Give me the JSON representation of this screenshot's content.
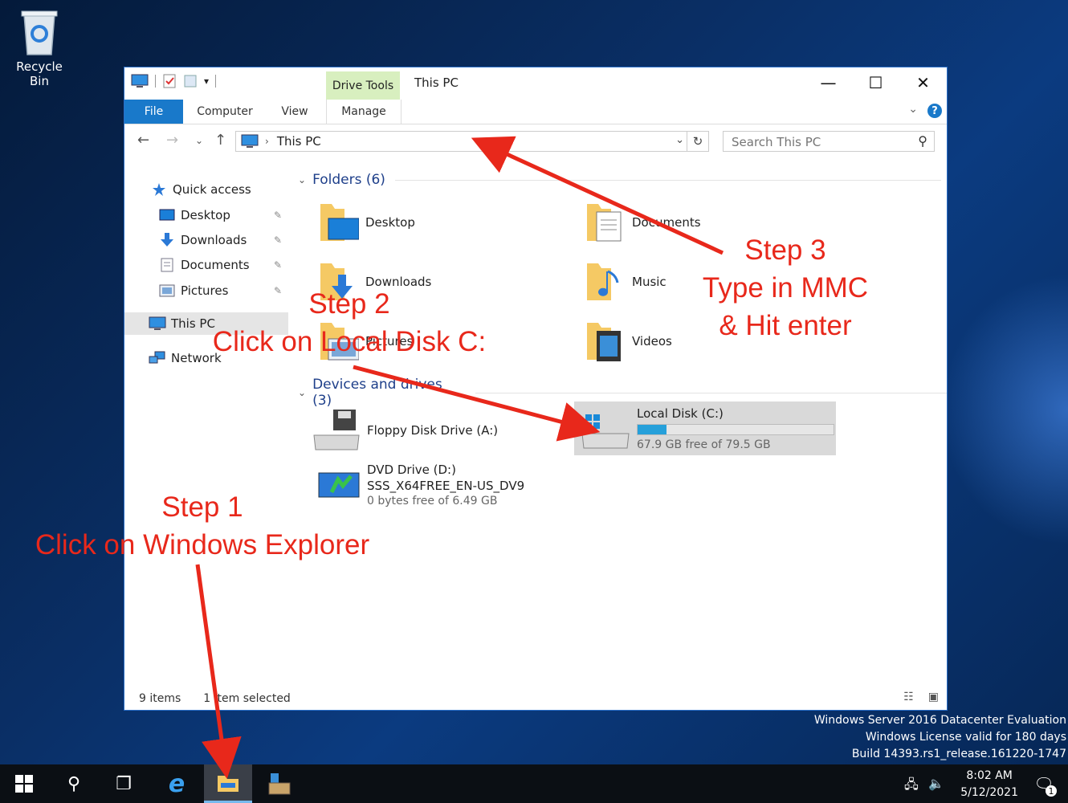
{
  "desktop": {
    "recycle_bin_label": "Recycle Bin"
  },
  "window": {
    "title": "This PC",
    "contextual_tab_header": "Drive Tools",
    "tabs": [
      {
        "label": "File"
      },
      {
        "label": "Computer"
      },
      {
        "label": "View"
      },
      {
        "label": "Manage"
      }
    ],
    "controls": {
      "minimize": "—",
      "maximize": "☐",
      "close": "✕"
    }
  },
  "address_bar": {
    "path": "This PC",
    "search_placeholder": "Search This PC"
  },
  "nav_pane": {
    "quick_access": "Quick access",
    "pinned": [
      {
        "label": "Desktop"
      },
      {
        "label": "Downloads"
      },
      {
        "label": "Documents"
      },
      {
        "label": "Pictures"
      }
    ],
    "this_pc": "This PC",
    "network": "Network"
  },
  "content": {
    "folders_header": "Folders (6)",
    "folders": [
      {
        "label": "Desktop"
      },
      {
        "label": "Documents"
      },
      {
        "label": "Downloads"
      },
      {
        "label": "Music"
      },
      {
        "label": "Pictures"
      },
      {
        "label": "Videos"
      }
    ],
    "devices_header": "Devices and drives (3)",
    "drives": {
      "floppy": {
        "label": "Floppy Disk Drive (A:)"
      },
      "local_disk": {
        "label": "Local Disk (C:)",
        "free_text": "67.9 GB free of 79.5 GB",
        "used_fraction": 0.146
      },
      "dvd": {
        "label": "DVD Drive (D:)",
        "volume": "SSS_X64FREE_EN-US_DV9",
        "free_text": "0 bytes free of 6.49 GB"
      }
    }
  },
  "status_bar": {
    "items_count": "9 items",
    "selected": "1 item selected"
  },
  "watermark": {
    "line1": "Windows Server 2016 Datacenter Evaluation",
    "line2": "Windows License valid for 180 days",
    "line3": "Build 14393.rs1_release.161220-1747"
  },
  "taskbar": {
    "time": "8:02 AM",
    "date": "5/12/2021",
    "notification_count": "1"
  },
  "annotations": {
    "step1_title": "Step 1",
    "step1_text": "Click on Windows Explorer",
    "step2_title": "Step 2",
    "step2_text": "Click on Local Disk C:",
    "step3_title": "Step 3",
    "step3_line1": "Type in MMC",
    "step3_line2": "& Hit enter"
  },
  "colors": {
    "annotation_red": "#e8281b",
    "ribbon_blue": "#1979ca",
    "drive_tools_green": "#d8efbf",
    "selection_gray": "#d9d9d9"
  }
}
